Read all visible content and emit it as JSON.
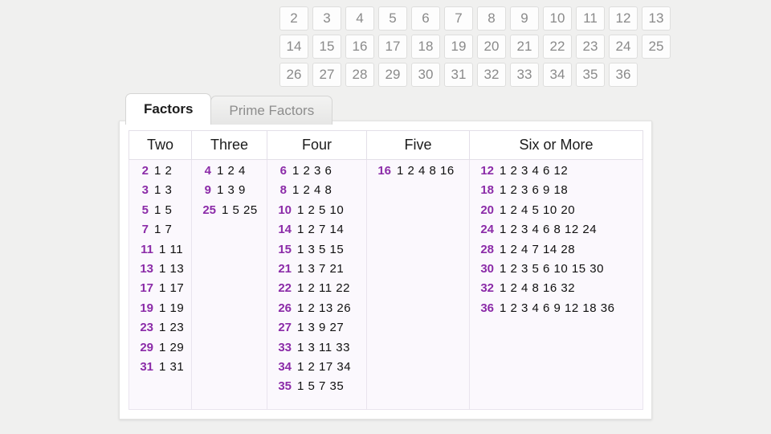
{
  "number_pad": {
    "rows": [
      [
        "2",
        "3",
        "4",
        "5",
        "6",
        "7",
        "8",
        "9",
        "10",
        "11",
        "12",
        "13"
      ],
      [
        "14",
        "15",
        "16",
        "17",
        "18",
        "19",
        "20",
        "21",
        "22",
        "23",
        "24",
        "25"
      ],
      [
        "26",
        "27",
        "28",
        "29",
        "30",
        "31",
        "32",
        "33",
        "34",
        "35",
        "36"
      ]
    ]
  },
  "tabs": [
    {
      "label": "Factors",
      "active": true
    },
    {
      "label": "Prime Factors",
      "active": false
    }
  ],
  "colors": {
    "accent_purple": "#8b2ba8",
    "page_background": "#f0f0ef",
    "panel_background": "#ffffff",
    "table_cell_background": "#fbf8fd",
    "button_text": "#8a8a8a"
  },
  "table": {
    "headers": [
      "Two",
      "Three",
      "Four",
      "Five",
      "Six or More"
    ],
    "columns": [
      {
        "header": "Two",
        "rows": [
          {
            "number": "2",
            "factors": "1 2"
          },
          {
            "number": "3",
            "factors": "1 3"
          },
          {
            "number": "5",
            "factors": "1 5"
          },
          {
            "number": "7",
            "factors": "1 7"
          },
          {
            "number": "11",
            "factors": "1 11"
          },
          {
            "number": "13",
            "factors": "1 13"
          },
          {
            "number": "17",
            "factors": "1 17"
          },
          {
            "number": "19",
            "factors": "1 19"
          },
          {
            "number": "23",
            "factors": "1 23"
          },
          {
            "number": "29",
            "factors": "1 29"
          },
          {
            "number": "31",
            "factors": "1 31"
          }
        ]
      },
      {
        "header": "Three",
        "rows": [
          {
            "number": "4",
            "factors": "1 2 4"
          },
          {
            "number": "9",
            "factors": "1 3 9"
          },
          {
            "number": "25",
            "factors": "1 5 25"
          }
        ]
      },
      {
        "header": "Four",
        "rows": [
          {
            "number": "6",
            "factors": "1 2 3 6"
          },
          {
            "number": "8",
            "factors": "1 2 4 8"
          },
          {
            "number": "10",
            "factors": "1 2 5 10"
          },
          {
            "number": "14",
            "factors": "1 2 7 14"
          },
          {
            "number": "15",
            "factors": "1 3 5 15"
          },
          {
            "number": "21",
            "factors": "1 3 7 21"
          },
          {
            "number": "22",
            "factors": "1 2 11 22"
          },
          {
            "number": "26",
            "factors": "1 2 13 26"
          },
          {
            "number": "27",
            "factors": "1 3 9 27"
          },
          {
            "number": "33",
            "factors": "1 3 11 33"
          },
          {
            "number": "34",
            "factors": "1 2 17 34"
          },
          {
            "number": "35",
            "factors": "1 5 7 35"
          }
        ]
      },
      {
        "header": "Five",
        "rows": [
          {
            "number": "16",
            "factors": "1 2 4 8 16"
          }
        ]
      },
      {
        "header": "Six or More",
        "rows": [
          {
            "number": "12",
            "factors": "1 2 3 4 6 12"
          },
          {
            "number": "18",
            "factors": "1 2 3 6 9 18"
          },
          {
            "number": "20",
            "factors": "1 2 4 5 10 20"
          },
          {
            "number": "24",
            "factors": "1 2 3 4 6 8 12 24"
          },
          {
            "number": "28",
            "factors": "1 2 4 7 14 28"
          },
          {
            "number": "30",
            "factors": "1 2 3 5 6 10 15 30"
          },
          {
            "number": "32",
            "factors": "1 2 4 8 16 32"
          },
          {
            "number": "36",
            "factors": "1 2 3 4 6 9 12 18 36"
          }
        ]
      }
    ]
  }
}
